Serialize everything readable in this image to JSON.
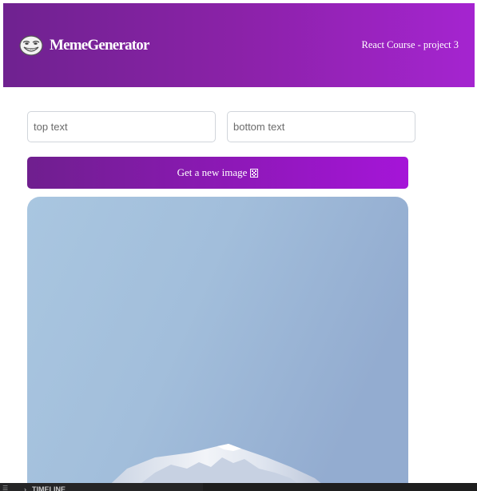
{
  "header": {
    "logo_icon": "troll-face-icon",
    "title": "MemeGenerator",
    "course_label": "React Course - project 3"
  },
  "form": {
    "top_text": {
      "value": "",
      "placeholder": "top text"
    },
    "bottom_text": {
      "value": "",
      "placeholder": "bottom text"
    },
    "button_label": "Get a new image",
    "button_icon": "image-icon"
  },
  "meme": {
    "image_icon": "mountain-photo"
  },
  "editor_panel": {
    "timeline_label": "TIMELINE"
  },
  "colors": {
    "header_gradient_start": "#6f2290",
    "header_gradient_end": "#a524d0",
    "button_gradient_start": "#6f1f8e",
    "button_gradient_end": "#a515d8",
    "sky": "#a4c0dc",
    "snow": "#eef1f6"
  }
}
